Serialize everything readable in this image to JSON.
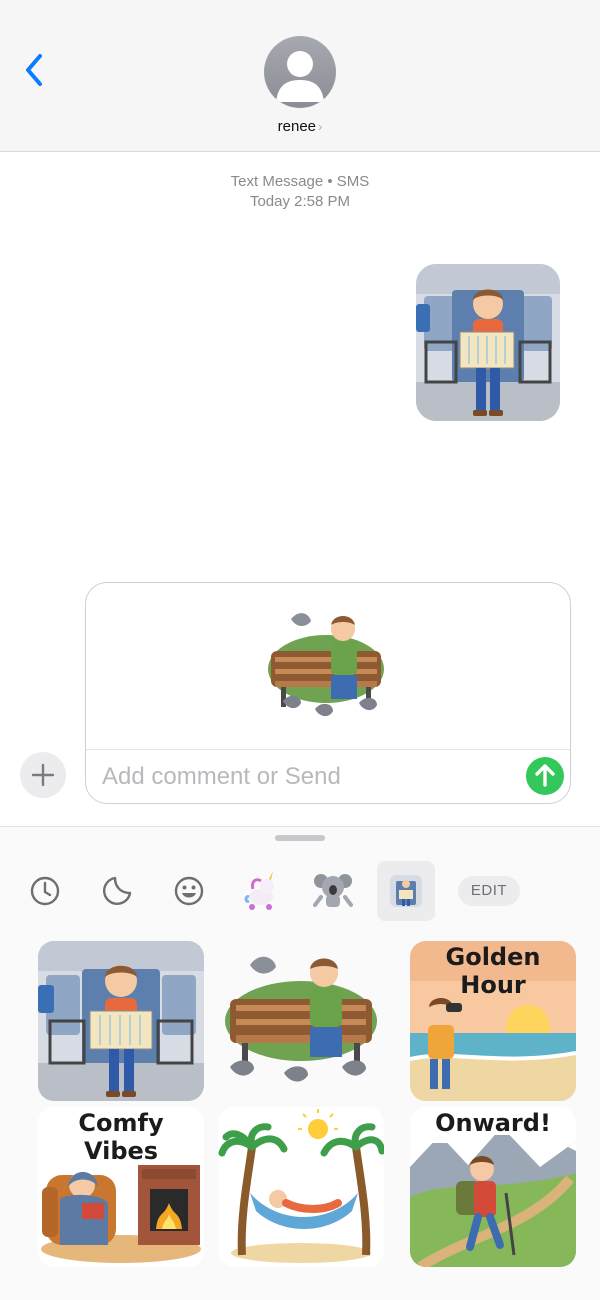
{
  "header": {
    "contact_name": "renee",
    "chevron": "›"
  },
  "conversation": {
    "service_label": "Text Message • SMS",
    "timestamp": "Today 2:58 PM"
  },
  "composer": {
    "placeholder": "Add comment or Send"
  },
  "drawer": {
    "edit_label": "EDIT",
    "tabs": [
      "recents-icon",
      "stickers-icon",
      "emoji-icon",
      "unicorn-sticker-pack",
      "koala-sticker-pack",
      "traveler-sticker-pack"
    ]
  },
  "stickers": [
    {
      "name": "traveler-map-train"
    },
    {
      "name": "pigeon-bench"
    },
    {
      "name": "golden-hour",
      "caption": "Golden Hour"
    },
    {
      "name": "comfy-vibes",
      "caption": "Comfy Vibes"
    },
    {
      "name": "hammock-palms"
    },
    {
      "name": "onward-hiker",
      "caption": "Onward!"
    }
  ],
  "colors": {
    "accent_blue": "#0a7cff",
    "send_green": "#34c759"
  }
}
